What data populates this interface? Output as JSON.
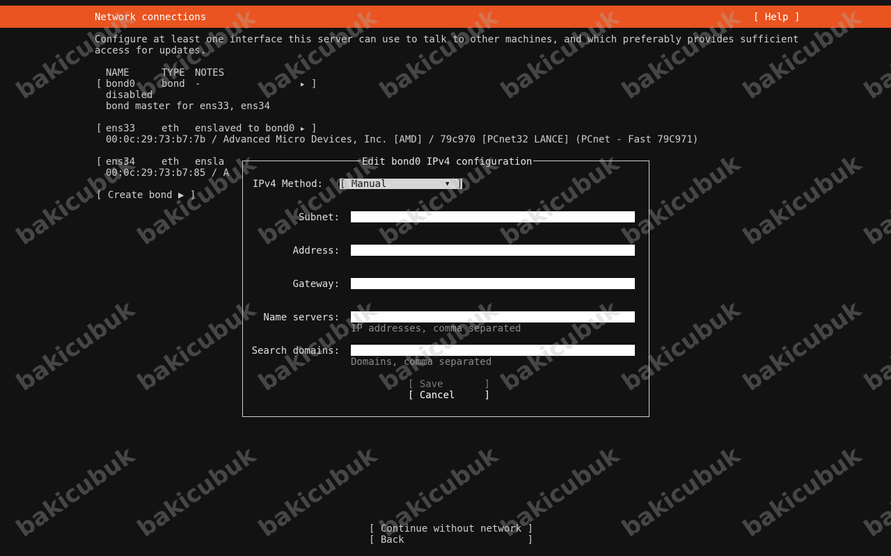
{
  "header": {
    "title": "Network connections",
    "help_label": "[ Help ]"
  },
  "intro": [
    "Configure at least one interface this server can use to talk to other machines, and which preferably provides sufficient",
    "access for updates."
  ],
  "table": {
    "headers": {
      "name": "NAME",
      "type": "TYPE",
      "notes": "NOTES"
    },
    "interfaces": [
      {
        "name": "bond0",
        "type": "bond",
        "notes": "-",
        "details": [
          "disabled",
          "bond master for ens33, ens34"
        ]
      },
      {
        "name": "ens33",
        "type": "eth",
        "notes": "enslaved to bond0",
        "details": [
          "00:0c:29:73:b7:7b / Advanced Micro Devices, Inc. [AMD] / 79c970 [PCnet32 LANCE] (PCnet - Fast 79C971)"
        ]
      },
      {
        "name": "ens34",
        "type": "eth",
        "notes": "ensla",
        "details": [
          "00:0c:29:73:b7:85 / A"
        ]
      }
    ],
    "create_bond_label": "[ Create bond ▶ ]"
  },
  "dialog": {
    "title": "Edit bond0 IPv4 configuration",
    "method_label": "IPv4 Method:",
    "method_value": "[ Manual",
    "fields": {
      "subnet": {
        "label": "Subnet:",
        "value": ""
      },
      "address": {
        "label": "Address:",
        "value": ""
      },
      "gateway": {
        "label": "Gateway:",
        "value": ""
      },
      "name_servers": {
        "label": "Name servers:",
        "value": "",
        "hint": "IP addresses, comma separated"
      },
      "search_domains": {
        "label": "Search domains:",
        "value": "",
        "hint": "Domains, comma separated"
      }
    },
    "save_label": "[ Save       ]",
    "cancel_label": "[ Cancel     ]"
  },
  "footer": {
    "continue_label": "[ Continue without network ]",
    "back_label": "[ Back                     ]"
  },
  "watermark": "bakicubuk",
  "colors": {
    "accent": "#e95420",
    "background": "#121212",
    "text": "#cfcfcf"
  },
  "icons": {
    "row_arrow": "triangle-right-icon",
    "dropdown": "triangle-down-icon"
  }
}
